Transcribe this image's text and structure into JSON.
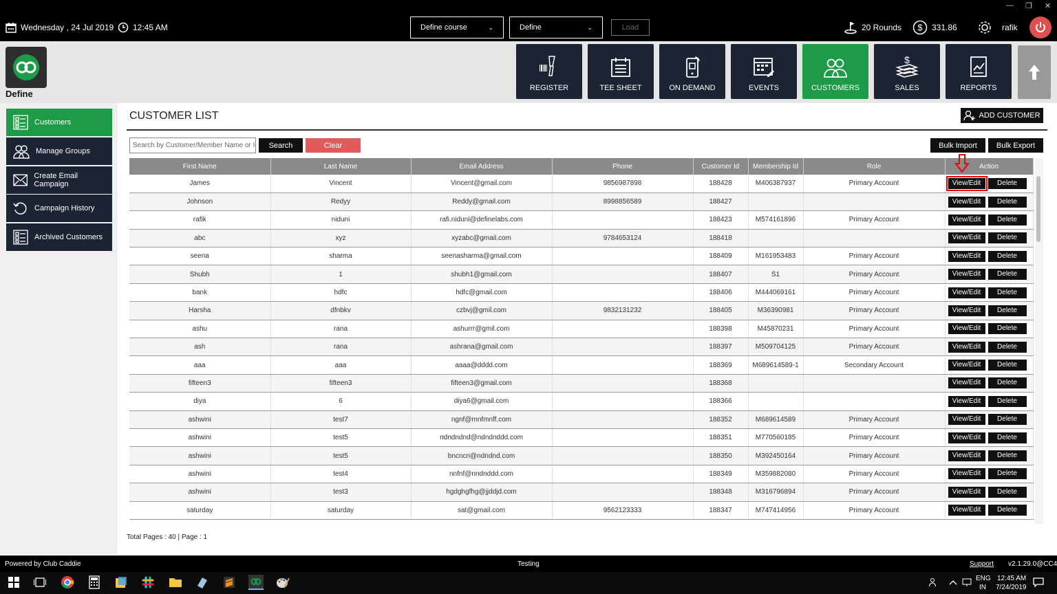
{
  "topbar": {
    "date": "Wednesday ,  24 Jul 2019",
    "time": "12:45 AM",
    "course_select": "Define course",
    "define_select": "Define",
    "load_label": "Load",
    "rounds": "20 Rounds",
    "balance": "331.86",
    "user": "rafik",
    "win_min": "—",
    "win_restore": "❐",
    "win_close": "✕"
  },
  "brand": {
    "name": "Define",
    "accent": "#1e9b46"
  },
  "nav": [
    {
      "label": "REGISTER",
      "icon": "barcode-scanner-icon"
    },
    {
      "label": "TEE SHEET",
      "icon": "calendar-list-icon"
    },
    {
      "label": "ON DEMAND",
      "icon": "mobile-phone-icon"
    },
    {
      "label": "EVENTS",
      "icon": "calendar-icon"
    },
    {
      "label": "CUSTOMERS",
      "icon": "users-icon",
      "active": true
    },
    {
      "label": "SALES",
      "icon": "money-icon"
    },
    {
      "label": "REPORTS",
      "icon": "report-icon"
    }
  ],
  "sidebar": [
    {
      "label": "Customers",
      "icon": "customer-card-icon",
      "active": true
    },
    {
      "label": "Manage Groups",
      "icon": "group-icon"
    },
    {
      "label": "Create Email Campaign",
      "icon": "envelope-icon"
    },
    {
      "label": "Campaign History",
      "icon": "history-icon"
    },
    {
      "label": "Archived Customers",
      "icon": "archive-icon"
    }
  ],
  "page": {
    "title": "CUSTOMER LIST",
    "add_customer": "ADD CUSTOMER",
    "search_placeholder": "Search by Customer/Member Name or Id",
    "search_label": "Search",
    "clear_label": "Clear",
    "bulk_import": "Bulk Import",
    "bulk_export": "Bulk Export",
    "pagination": "Total Pages : 40 | Page : 1"
  },
  "table": {
    "columns": [
      "First Name",
      "Last Name",
      "Email Address",
      "Phone",
      "Customer Id",
      "Membership Id",
      "Role",
      "Action"
    ],
    "view_label": "View/Edit",
    "delete_label": "Delete",
    "rows": [
      [
        "James",
        "Vincent",
        "Vincent@gmail.com",
        "9856987898",
        "188428",
        "M406387937",
        "Primary Account"
      ],
      [
        "Johnson",
        "Redyy",
        "Reddy@gmail.com",
        "8998856589",
        "188427",
        "",
        ""
      ],
      [
        "rafik",
        "niduni",
        "rafi.niduni@definelabs.com",
        "",
        "188423",
        "M574161896",
        "Primary Account"
      ],
      [
        "abc",
        "xyz",
        "xyzabc@gmail.com",
        "9784653124",
        "188418",
        "",
        ""
      ],
      [
        "seena",
        "sharma",
        "seenasharma@gmail.com",
        "",
        "188409",
        "M161953483",
        "Primary Account"
      ],
      [
        "Shubh",
        "1",
        "shubh1@gmail.com",
        "",
        "188407",
        "S1",
        "Primary Account"
      ],
      [
        "bank",
        "hdfc",
        "hdfc@gmail.com",
        "",
        "188406",
        "M444069161",
        "Primary Account"
      ],
      [
        "Harsha",
        "dfnbkv",
        "czbvj@gmil.com",
        "9832131232",
        "188405",
        "M36390981",
        "Primary Account"
      ],
      [
        "ashu",
        "rana",
        "ashurrr@gmil.com",
        "",
        "188398",
        "M45870231",
        "Primary Account"
      ],
      [
        "ash",
        "rana",
        "ashrana@gmail.com",
        "",
        "188397",
        "M509704125",
        "Primary Account"
      ],
      [
        "aaa",
        "aaa",
        "aaaa@dddd.com",
        "",
        "188369",
        "M689614589-1",
        "Secondary Account"
      ],
      [
        "fifteen3",
        "fifteen3",
        "fifteen3@gmail.com",
        "",
        "188368",
        "",
        ""
      ],
      [
        "diya",
        "6",
        "diya6@gmail.com",
        "",
        "188366",
        "",
        ""
      ],
      [
        "ashwini",
        "test7",
        "ngnf@mnfmnff.com",
        "",
        "188352",
        "M689614589",
        "Primary Account"
      ],
      [
        "ashwini",
        "test5",
        "ndndndnd@ndndnddd.com",
        "",
        "188351",
        "M770560185",
        "Primary Account"
      ],
      [
        "ashwini",
        "test5",
        "bncncn@ndndnd.com",
        "",
        "188350",
        "M392450164",
        "Primary Account"
      ],
      [
        "ashwini",
        "test4",
        "nnfnf@nndnddd.com",
        "",
        "188349",
        "M359882080",
        "Primary Account"
      ],
      [
        "ashwini",
        "test3",
        "hgdghgfhg@jjddjd.com",
        "",
        "188348",
        "M316796894",
        "Primary Account"
      ],
      [
        "saturday",
        "saturday",
        "sat@gmail.com",
        "9562123333",
        "188347",
        "M747414956",
        "Primary Account"
      ]
    ]
  },
  "footer": {
    "powered": "Powered by Club Caddie",
    "env": "Testing",
    "support": "Support",
    "version": "v2.1.29.0@CC4"
  },
  "taskbar": {
    "lang": "ENG",
    "region": "IN",
    "time": "12:45 AM",
    "date": "7/24/2019"
  }
}
